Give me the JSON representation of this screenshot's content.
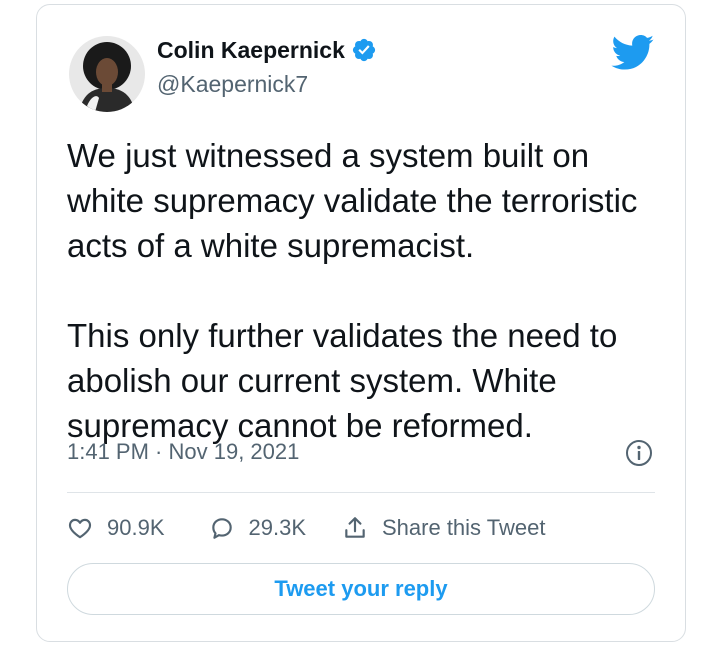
{
  "user": {
    "display_name": "Colin Kaepernick",
    "handle": "@Kaepernick7",
    "verified": true
  },
  "tweet": {
    "paragraphs": [
      "We just witnessed a system built on white supremacy validate the terroristic acts of a white supremacist.",
      "This only further validates the need to abolish our current system. White supremacy cannot be reformed."
    ],
    "timestamp": "1:41 PM · Nov 19, 2021"
  },
  "actions": {
    "likes": "90.9K",
    "replies": "29.3K",
    "share_label": "Share this Tweet"
  },
  "reply_button_label": "Tweet your reply",
  "icons": {
    "brand": "twitter-bird-icon",
    "verified": "verified-badge-icon",
    "info": "info-icon",
    "like": "heart-icon",
    "reply": "comment-icon",
    "share": "share-icon"
  },
  "colors": {
    "accent": "#1d9bf0",
    "text_primary": "#0f1419",
    "text_secondary": "#536471",
    "border": "#d9dee2"
  }
}
